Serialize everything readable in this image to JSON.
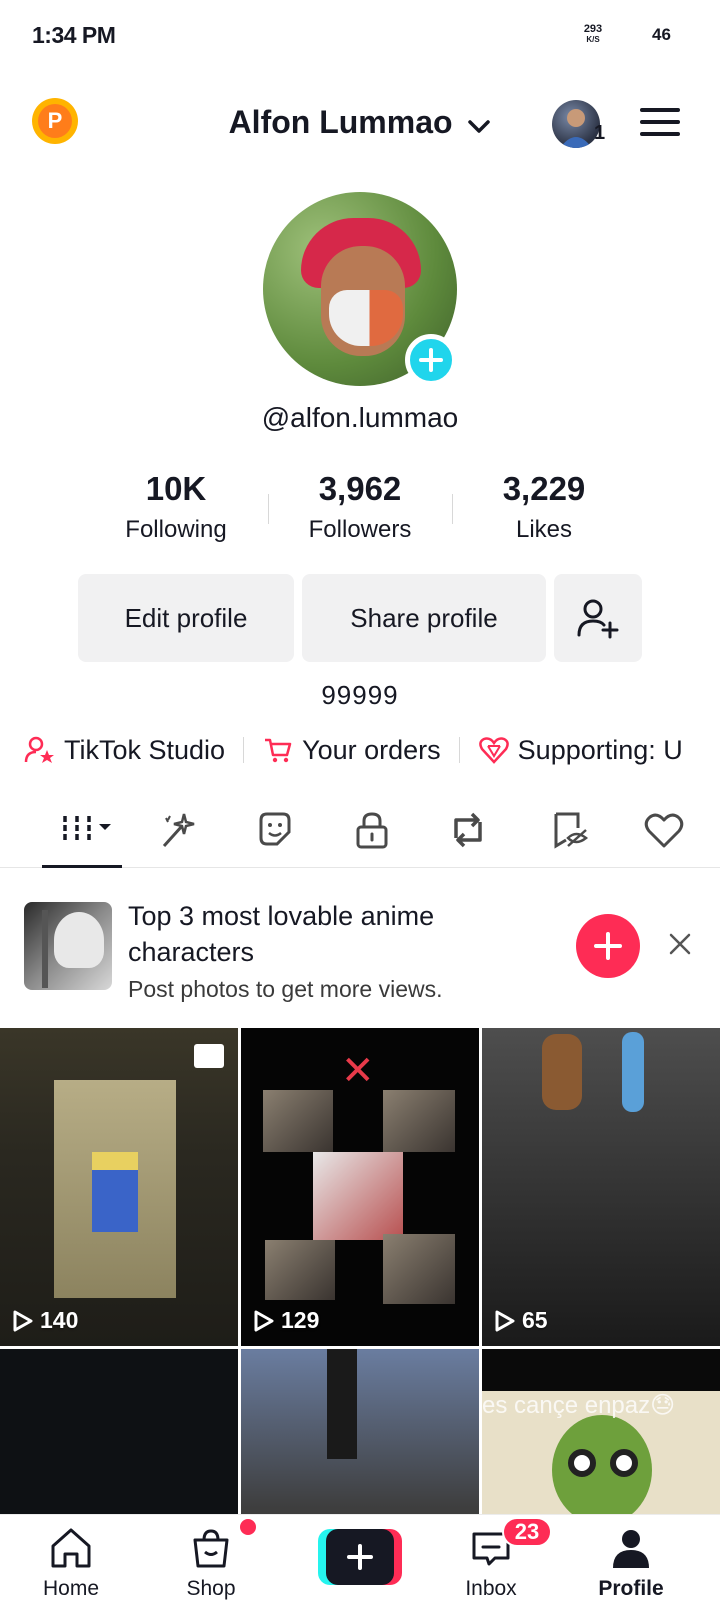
{
  "status_bar": {
    "time": "1:34 PM",
    "net_speed_value": "293",
    "net_speed_unit": "K/S",
    "battery": "46"
  },
  "header": {
    "account_name": "Alfon Lummao",
    "switch_account_count": "1",
    "points_icon_letter": "P"
  },
  "profile": {
    "username": "@alfon.lummao",
    "stats": [
      {
        "value": "10K",
        "label": "Following"
      },
      {
        "value": "3,962",
        "label": "Followers"
      },
      {
        "value": "3,229",
        "label": "Likes"
      }
    ],
    "buttons": {
      "edit": "Edit profile",
      "share": "Share profile"
    },
    "bio": "99999"
  },
  "links": [
    {
      "icon": "studio-icon",
      "label": "TikTok Studio"
    },
    {
      "icon": "cart-icon",
      "label": "Your orders"
    },
    {
      "icon": "heart-gem-icon",
      "label": "Supporting: U"
    }
  ],
  "tabs": [
    "videos",
    "favorites-sparkle",
    "stickers",
    "private",
    "reposts",
    "hidden",
    "liked"
  ],
  "promo": {
    "title": "Top 3 most lovable anime characters",
    "subtitle": "Post photos to get more views."
  },
  "videos": [
    {
      "views": "140"
    },
    {
      "views": "129"
    },
    {
      "views": "65"
    },
    {
      "views": ""
    },
    {
      "views": ""
    },
    {
      "views": "",
      "caption": "es cançe enpaz😓"
    }
  ],
  "bottom_nav": {
    "home": "Home",
    "shop": "Shop",
    "inbox": "Inbox",
    "inbox_badge": "23",
    "profile": "Profile"
  },
  "colors": {
    "accent": "#fe2c55",
    "cyan": "#20d5ec",
    "button_bg": "#f1f1f2",
    "text": "#161823"
  }
}
